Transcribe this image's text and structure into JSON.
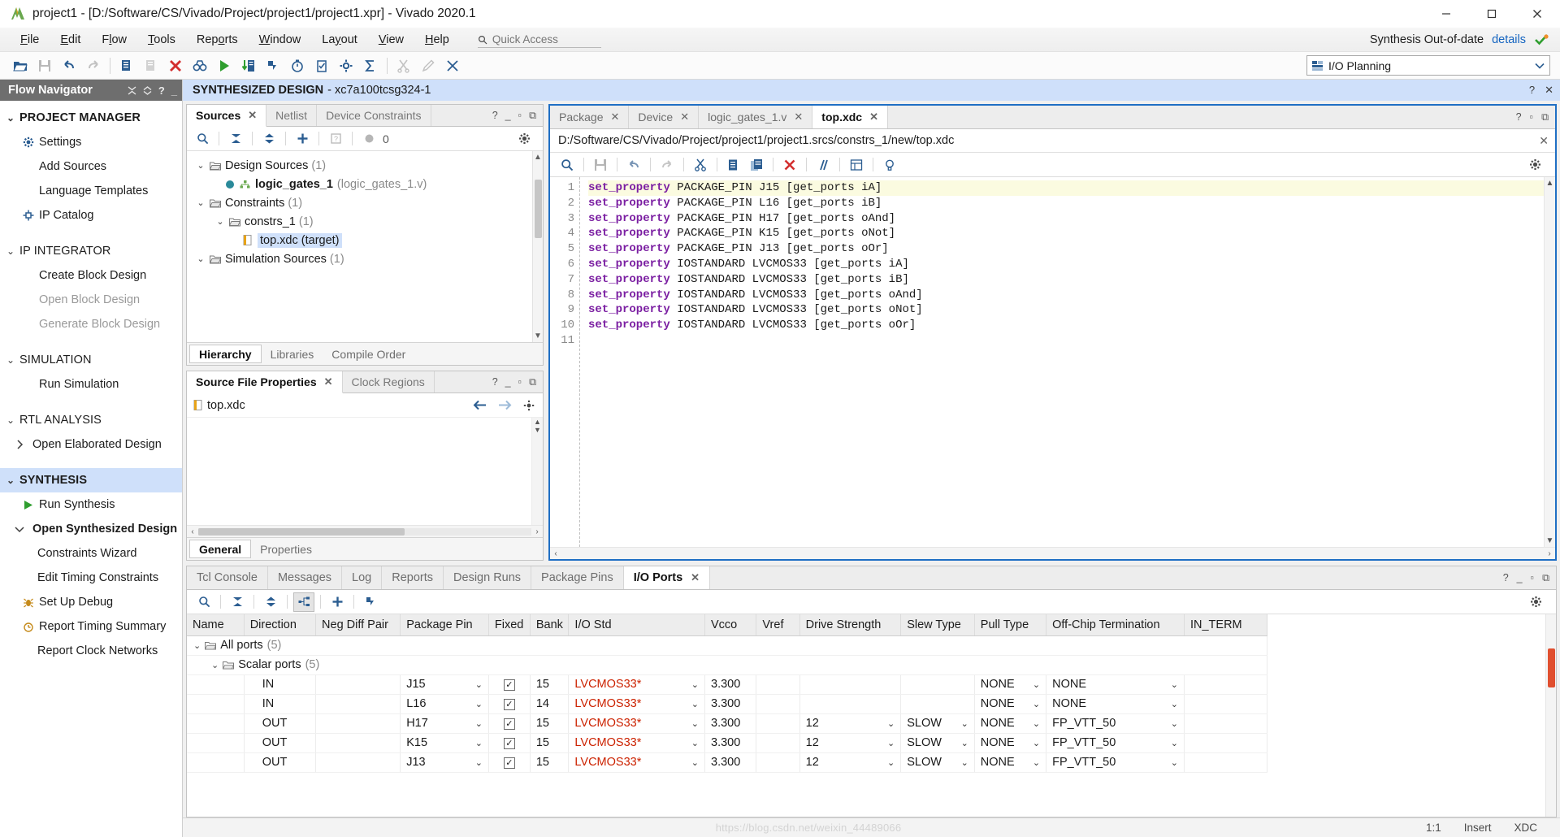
{
  "window": {
    "title": "project1 - [D:/Software/CS/Vivado/Project/project1/project1.xpr] - Vivado 2020.1",
    "minimize": "–",
    "maximize": "□",
    "close": "✕"
  },
  "menu": {
    "items": [
      "File",
      "Edit",
      "Flow",
      "Tools",
      "Reports",
      "Window",
      "Layout",
      "View",
      "Help"
    ],
    "quick_access_placeholder": "Quick Access",
    "synth_status": "Synthesis Out-of-date",
    "details_label": "details"
  },
  "toolbar": {
    "layout_label": "I/O Planning",
    "buttons": [
      "open-folder",
      "save",
      "undo",
      "redo",
      "copy",
      "paste",
      "delete-x",
      "search-binoculars",
      "run-play",
      "report-run",
      "next-step",
      "timer",
      "validate",
      "settings-gear",
      "sigma",
      "cut2",
      "edit-pencil",
      "cross-probe"
    ]
  },
  "flow_navigator": {
    "title": "Flow Navigator",
    "groups": [
      {
        "label": "PROJECT MANAGER",
        "bold": true,
        "selected": false,
        "items": [
          {
            "label": "Settings",
            "icon": "gear-icon",
            "disabled": false,
            "bold": false
          },
          {
            "label": "Add Sources",
            "icon": "",
            "disabled": false,
            "bold": false
          },
          {
            "label": "Language Templates",
            "icon": "",
            "disabled": false,
            "bold": false
          },
          {
            "label": "IP Catalog",
            "icon": "ip-icon",
            "disabled": false,
            "bold": false
          }
        ]
      },
      {
        "label": "IP INTEGRATOR",
        "bold": false,
        "selected": false,
        "items": [
          {
            "label": "Create Block Design",
            "icon": "",
            "disabled": false,
            "bold": false
          },
          {
            "label": "Open Block Design",
            "icon": "",
            "disabled": true,
            "bold": false
          },
          {
            "label": "Generate Block Design",
            "icon": "",
            "disabled": true,
            "bold": false
          }
        ]
      },
      {
        "label": "SIMULATION",
        "bold": false,
        "selected": false,
        "items": [
          {
            "label": "Run Simulation",
            "icon": "",
            "disabled": false,
            "bold": false
          }
        ]
      },
      {
        "label": "RTL ANALYSIS",
        "bold": false,
        "selected": false,
        "items": [
          {
            "label": "Open Elaborated Design",
            "icon": "chevron-right-icon",
            "disabled": false,
            "bold": false
          }
        ]
      },
      {
        "label": "SYNTHESIS",
        "bold": true,
        "selected": true,
        "items": [
          {
            "label": "Run Synthesis",
            "icon": "play-icon",
            "disabled": false,
            "bold": false
          },
          {
            "label": "Open Synthesized Design",
            "icon": "chevron-down-icon",
            "disabled": false,
            "bold": true
          },
          {
            "label": "Constraints Wizard",
            "icon": "",
            "disabled": false,
            "bold": false,
            "level": 2
          },
          {
            "label": "Edit Timing Constraints",
            "icon": "",
            "disabled": false,
            "bold": false,
            "level": 2
          },
          {
            "label": "Set Up Debug",
            "icon": "bug-icon",
            "disabled": false,
            "bold": false,
            "level": 2
          },
          {
            "label": "Report Timing Summary",
            "icon": "clock-icon",
            "disabled": false,
            "bold": false,
            "level": 2
          },
          {
            "label": "Report Clock Networks",
            "icon": "",
            "disabled": false,
            "bold": false,
            "level": 2
          }
        ]
      }
    ]
  },
  "design_bar": {
    "title": "SYNTHESIZED DESIGN",
    "device": "- xc7a100tcsg324-1",
    "help": "?",
    "close": "✕"
  },
  "sources_panel": {
    "tabs": [
      {
        "label": "Sources",
        "active": true,
        "closable": true
      },
      {
        "label": "Netlist",
        "active": false,
        "closable": false
      },
      {
        "label": "Device Constraints",
        "active": false,
        "closable": false
      }
    ],
    "toolbar_icons": [
      "search-icon",
      "collapse-all-icon",
      "expand-all-icon",
      "add-icon",
      "help-icon",
      "status-dot-icon"
    ],
    "status_count": "0",
    "tree": [
      {
        "label": "Design Sources",
        "count": "(1)",
        "indent": 0,
        "chev": "v",
        "icon": "folder-icon",
        "bold": false
      },
      {
        "label": "logic_gates_1",
        "suffix": "(logic_gates_1.v)",
        "indent": 1,
        "chev": "",
        "icon": "module-icon",
        "bold": true
      },
      {
        "label": "Constraints",
        "count": "(1)",
        "indent": 0,
        "chev": "v",
        "icon": "folder-icon",
        "bold": false
      },
      {
        "label": "constrs_1",
        "count": "(1)",
        "indent": 1,
        "chev": "v",
        "icon": "folder-icon",
        "bold": false
      },
      {
        "label": "top.xdc (target)",
        "indent": 2,
        "chev": "",
        "icon": "file-icon",
        "bold": false,
        "selected": true
      },
      {
        "label": "Simulation Sources",
        "count": "(1)",
        "indent": 0,
        "chev": "v",
        "icon": "folder-icon",
        "bold": false
      }
    ],
    "footer_tabs": [
      {
        "label": "Hierarchy",
        "active": true
      },
      {
        "label": "Libraries",
        "active": false
      },
      {
        "label": "Compile Order",
        "active": false
      }
    ]
  },
  "properties_panel": {
    "tabs": [
      {
        "label": "Source File Properties",
        "active": true,
        "closable": true
      },
      {
        "label": "Clock Regions",
        "active": false,
        "closable": false
      }
    ],
    "file_name": "top.xdc",
    "footer_tabs": [
      {
        "label": "General",
        "active": true
      },
      {
        "label": "Properties",
        "active": false
      }
    ]
  },
  "editor": {
    "tabs": [
      {
        "label": "Package",
        "active": false,
        "closable": true
      },
      {
        "label": "Device",
        "active": false,
        "closable": true
      },
      {
        "label": "logic_gates_1.v",
        "active": false,
        "closable": true
      },
      {
        "label": "top.xdc",
        "active": true,
        "closable": true
      }
    ],
    "file_path": "D:/Software/CS/Vivado/Project/project1/project1.srcs/constrs_1/new/top.xdc",
    "toolbar_icons": [
      "search-icon",
      "save-icon",
      "undo-icon",
      "redo-icon",
      "cut-icon",
      "copy-icon",
      "paste-icon",
      "delete-icon",
      "comment-icon",
      "indent-icon",
      "bulb-icon",
      "gear-icon"
    ],
    "line_numbers": [
      "1",
      "2",
      "3",
      "4",
      "5",
      "6",
      "7",
      "8",
      "9",
      "10",
      "11"
    ],
    "lines": [
      {
        "cmd": "set_property",
        "prop": "PACKAGE_PIN",
        "val": "J15",
        "get": "[get_ports",
        "port": "iA]",
        "highlight": true
      },
      {
        "cmd": "set_property",
        "prop": "PACKAGE_PIN",
        "val": "L16",
        "get": "[get_ports",
        "port": "iB]",
        "highlight": false
      },
      {
        "cmd": "set_property",
        "prop": "PACKAGE_PIN",
        "val": "H17",
        "get": "[get_ports",
        "port": "oAnd]",
        "highlight": false
      },
      {
        "cmd": "set_property",
        "prop": "PACKAGE_PIN",
        "val": "K15",
        "get": "[get_ports",
        "port": "oNot]",
        "highlight": false
      },
      {
        "cmd": "set_property",
        "prop": "PACKAGE_PIN",
        "val": "J13",
        "get": "[get_ports",
        "port": "oOr]",
        "highlight": false
      },
      {
        "cmd": "set_property",
        "prop": "IOSTANDARD",
        "val": "LVCMOS33",
        "get": "[get_ports",
        "port": "iA]",
        "highlight": false
      },
      {
        "cmd": "set_property",
        "prop": "IOSTANDARD",
        "val": "LVCMOS33",
        "get": "[get_ports",
        "port": "iB]",
        "highlight": false
      },
      {
        "cmd": "set_property",
        "prop": "IOSTANDARD",
        "val": "LVCMOS33",
        "get": "[get_ports",
        "port": "oAnd]",
        "highlight": false
      },
      {
        "cmd": "set_property",
        "prop": "IOSTANDARD",
        "val": "LVCMOS33",
        "get": "[get_ports",
        "port": "oNot]",
        "highlight": false
      },
      {
        "cmd": "set_property",
        "prop": "IOSTANDARD",
        "val": "LVCMOS33",
        "get": "[get_ports",
        "port": "oOr]",
        "highlight": false
      },
      {
        "cmd": "",
        "prop": "",
        "val": "",
        "get": "",
        "port": "",
        "highlight": false
      }
    ]
  },
  "bottom_panel": {
    "tabs": [
      {
        "label": "Tcl Console",
        "active": false,
        "closable": false
      },
      {
        "label": "Messages",
        "active": false,
        "closable": false
      },
      {
        "label": "Log",
        "active": false,
        "closable": false
      },
      {
        "label": "Reports",
        "active": false,
        "closable": false
      },
      {
        "label": "Design Runs",
        "active": false,
        "closable": false
      },
      {
        "label": "Package Pins",
        "active": false,
        "closable": false
      },
      {
        "label": "I/O Ports",
        "active": true,
        "closable": true
      }
    ],
    "toolbar_icons": [
      "search-icon",
      "collapse-all-icon",
      "expand-all-icon",
      "tree-view-icon",
      "add-icon",
      "export-icon"
    ],
    "columns": [
      "Name",
      "Direction",
      "Neg Diff Pair",
      "Package Pin",
      "Fixed",
      "Bank",
      "I/O Std",
      "Vcco",
      "Vref",
      "Drive Strength",
      "Slew Type",
      "Pull Type",
      "Off-Chip Termination",
      "IN_TERM"
    ],
    "groups": [
      {
        "label": "All ports",
        "count": "(5)",
        "indent": 0
      },
      {
        "label": "Scalar ports",
        "count": "(5)",
        "indent": 1
      }
    ],
    "rows": [
      {
        "name": "",
        "direction": "IN",
        "neg_diff": "",
        "package_pin": "J15",
        "fixed": "✓",
        "bank": "15",
        "io_std": "LVCMOS33*",
        "vcco": "3.300",
        "vref": "",
        "drive": "",
        "slew": "",
        "pull": "NONE",
        "offchip": "NONE",
        "in_term": ""
      },
      {
        "name": "",
        "direction": "IN",
        "neg_diff": "",
        "package_pin": "L16",
        "fixed": "✓",
        "bank": "14",
        "io_std": "LVCMOS33*",
        "vcco": "3.300",
        "vref": "",
        "drive": "",
        "slew": "",
        "pull": "NONE",
        "offchip": "NONE",
        "in_term": ""
      },
      {
        "name": "",
        "direction": "OUT",
        "neg_diff": "",
        "package_pin": "H17",
        "fixed": "✓",
        "bank": "15",
        "io_std": "LVCMOS33*",
        "vcco": "3.300",
        "vref": "",
        "drive": "12",
        "slew": "SLOW",
        "pull": "NONE",
        "offchip": "FP_VTT_50",
        "in_term": ""
      },
      {
        "name": "",
        "direction": "OUT",
        "neg_diff": "",
        "package_pin": "K15",
        "fixed": "✓",
        "bank": "15",
        "io_std": "LVCMOS33*",
        "vcco": "3.300",
        "vref": "",
        "drive": "12",
        "slew": "SLOW",
        "pull": "NONE",
        "offchip": "FP_VTT_50",
        "in_term": ""
      },
      {
        "name": "",
        "direction": "OUT",
        "neg_diff": "",
        "package_pin": "J13",
        "fixed": "✓",
        "bank": "15",
        "io_std": "LVCMOS33*",
        "vcco": "3.300",
        "vref": "",
        "drive": "12",
        "slew": "SLOW",
        "pull": "NONE",
        "offchip": "FP_VTT_50",
        "in_term": ""
      }
    ]
  },
  "status_bar": {
    "watermark": "https://blog.csdn.net/weixin_44489066",
    "cursor_position": "1:1",
    "insert_mode": "Insert",
    "file_type": "XDC"
  },
  "colors": {
    "accent_blue": "#1f6fc4",
    "selection_blue": "#cfe0fa",
    "keyword_purple": "#7b1fa2",
    "error_red": "#cc2200",
    "link_blue": "#1464c0",
    "nav_header_gray": "#6e6e6e"
  }
}
